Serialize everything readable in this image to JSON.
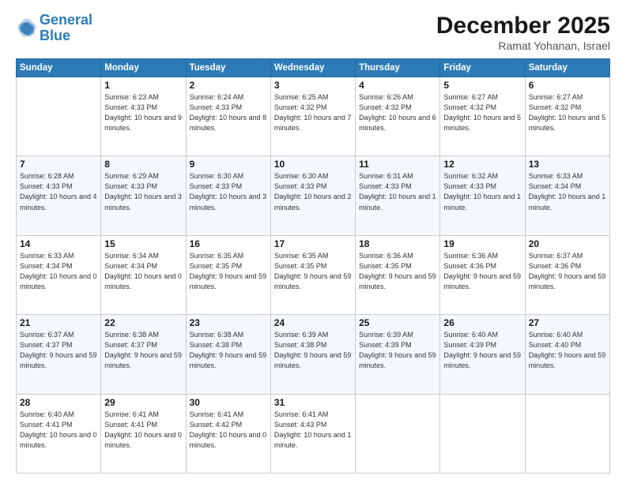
{
  "header": {
    "logo_line1": "General",
    "logo_line2": "Blue",
    "month": "December 2025",
    "location": "Ramat Yohanan, Israel"
  },
  "weekdays": [
    "Sunday",
    "Monday",
    "Tuesday",
    "Wednesday",
    "Thursday",
    "Friday",
    "Saturday"
  ],
  "weeks": [
    [
      {
        "day": "",
        "info": ""
      },
      {
        "day": "1",
        "info": "Sunrise: 6:23 AM\nSunset: 4:33 PM\nDaylight: 10 hours\nand 9 minutes."
      },
      {
        "day": "2",
        "info": "Sunrise: 6:24 AM\nSunset: 4:33 PM\nDaylight: 10 hours\nand 8 minutes."
      },
      {
        "day": "3",
        "info": "Sunrise: 6:25 AM\nSunset: 4:32 PM\nDaylight: 10 hours\nand 7 minutes."
      },
      {
        "day": "4",
        "info": "Sunrise: 6:26 AM\nSunset: 4:32 PM\nDaylight: 10 hours\nand 6 minutes."
      },
      {
        "day": "5",
        "info": "Sunrise: 6:27 AM\nSunset: 4:32 PM\nDaylight: 10 hours\nand 5 minutes."
      },
      {
        "day": "6",
        "info": "Sunrise: 6:27 AM\nSunset: 4:32 PM\nDaylight: 10 hours\nand 5 minutes."
      }
    ],
    [
      {
        "day": "7",
        "info": "Sunrise: 6:28 AM\nSunset: 4:33 PM\nDaylight: 10 hours\nand 4 minutes."
      },
      {
        "day": "8",
        "info": "Sunrise: 6:29 AM\nSunset: 4:33 PM\nDaylight: 10 hours\nand 3 minutes."
      },
      {
        "day": "9",
        "info": "Sunrise: 6:30 AM\nSunset: 4:33 PM\nDaylight: 10 hours\nand 3 minutes."
      },
      {
        "day": "10",
        "info": "Sunrise: 6:30 AM\nSunset: 4:33 PM\nDaylight: 10 hours\nand 2 minutes."
      },
      {
        "day": "11",
        "info": "Sunrise: 6:31 AM\nSunset: 4:33 PM\nDaylight: 10 hours\nand 1 minute."
      },
      {
        "day": "12",
        "info": "Sunrise: 6:32 AM\nSunset: 4:33 PM\nDaylight: 10 hours\nand 1 minute."
      },
      {
        "day": "13",
        "info": "Sunrise: 6:33 AM\nSunset: 4:34 PM\nDaylight: 10 hours\nand 1 minute."
      }
    ],
    [
      {
        "day": "14",
        "info": "Sunrise: 6:33 AM\nSunset: 4:34 PM\nDaylight: 10 hours\nand 0 minutes."
      },
      {
        "day": "15",
        "info": "Sunrise: 6:34 AM\nSunset: 4:34 PM\nDaylight: 10 hours\nand 0 minutes."
      },
      {
        "day": "16",
        "info": "Sunrise: 6:35 AM\nSunset: 4:35 PM\nDaylight: 9 hours\nand 59 minutes."
      },
      {
        "day": "17",
        "info": "Sunrise: 6:35 AM\nSunset: 4:35 PM\nDaylight: 9 hours\nand 59 minutes."
      },
      {
        "day": "18",
        "info": "Sunrise: 6:36 AM\nSunset: 4:35 PM\nDaylight: 9 hours\nand 59 minutes."
      },
      {
        "day": "19",
        "info": "Sunrise: 6:36 AM\nSunset: 4:36 PM\nDaylight: 9 hours\nand 59 minutes."
      },
      {
        "day": "20",
        "info": "Sunrise: 6:37 AM\nSunset: 4:36 PM\nDaylight: 9 hours\nand 59 minutes."
      }
    ],
    [
      {
        "day": "21",
        "info": "Sunrise: 6:37 AM\nSunset: 4:37 PM\nDaylight: 9 hours\nand 59 minutes."
      },
      {
        "day": "22",
        "info": "Sunrise: 6:38 AM\nSunset: 4:37 PM\nDaylight: 9 hours\nand 59 minutes."
      },
      {
        "day": "23",
        "info": "Sunrise: 6:38 AM\nSunset: 4:38 PM\nDaylight: 9 hours\nand 59 minutes."
      },
      {
        "day": "24",
        "info": "Sunrise: 6:39 AM\nSunset: 4:38 PM\nDaylight: 9 hours\nand 59 minutes."
      },
      {
        "day": "25",
        "info": "Sunrise: 6:39 AM\nSunset: 4:39 PM\nDaylight: 9 hours\nand 59 minutes."
      },
      {
        "day": "26",
        "info": "Sunrise: 6:40 AM\nSunset: 4:39 PM\nDaylight: 9 hours\nand 59 minutes."
      },
      {
        "day": "27",
        "info": "Sunrise: 6:40 AM\nSunset: 4:40 PM\nDaylight: 9 hours\nand 59 minutes."
      }
    ],
    [
      {
        "day": "28",
        "info": "Sunrise: 6:40 AM\nSunset: 4:41 PM\nDaylight: 10 hours\nand 0 minutes."
      },
      {
        "day": "29",
        "info": "Sunrise: 6:41 AM\nSunset: 4:41 PM\nDaylight: 10 hours\nand 0 minutes."
      },
      {
        "day": "30",
        "info": "Sunrise: 6:41 AM\nSunset: 4:42 PM\nDaylight: 10 hours\nand 0 minutes."
      },
      {
        "day": "31",
        "info": "Sunrise: 6:41 AM\nSunset: 4:43 PM\nDaylight: 10 hours\nand 1 minute."
      },
      {
        "day": "",
        "info": ""
      },
      {
        "day": "",
        "info": ""
      },
      {
        "day": "",
        "info": ""
      }
    ]
  ]
}
